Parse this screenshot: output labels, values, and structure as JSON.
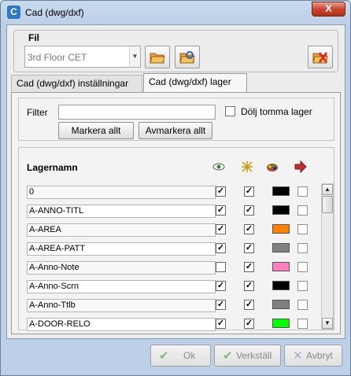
{
  "window": {
    "title": "Cad (dwg/dxf)",
    "close_glyph": "X"
  },
  "fil": {
    "legend": "Fil",
    "selected_file": "3rd Floor CET",
    "buttons": [
      {
        "name": "open-folder-button",
        "icon": "folder-open-icon"
      },
      {
        "name": "reload-file-button",
        "icon": "folder-refresh-icon"
      },
      {
        "name": "remove-file-button",
        "icon": "folder-delete-icon"
      }
    ]
  },
  "tabs": [
    {
      "label": "Cad (dwg/dxf) inställningar",
      "active": false
    },
    {
      "label": "Cad (dwg/dxf) lager",
      "active": true
    }
  ],
  "filter": {
    "label": "Filter",
    "value": "",
    "hide_empty_label": "Dölj tomma lager",
    "hide_empty_checked": false,
    "mark_all": "Markera allt",
    "unmark_all": "Avmarkera allt"
  },
  "grid": {
    "header_name": "Lagernamn",
    "header_icons": [
      "eye-icon",
      "freeze-icon",
      "color-palette-icon",
      "export-arrow-icon"
    ],
    "rows": [
      {
        "name": "0",
        "visible": true,
        "locked": true,
        "color": "#000000",
        "export": false
      },
      {
        "name": "A-ANNO-TITL",
        "visible": true,
        "locked": true,
        "color": "#000000",
        "export": false
      },
      {
        "name": "A-AREA",
        "visible": true,
        "locked": true,
        "color": "#ff7f00",
        "export": false
      },
      {
        "name": "A-AREA-PATT",
        "visible": true,
        "locked": true,
        "color": "#808080",
        "export": false
      },
      {
        "name": "A-Anno-Note",
        "visible": false,
        "locked": true,
        "color": "#ff80c0",
        "export": false
      },
      {
        "name": "A-Anno-Scrn",
        "visible": true,
        "locked": true,
        "color": "#000000",
        "export": false
      },
      {
        "name": "A-Anno-Ttlb",
        "visible": true,
        "locked": true,
        "color": "#808080",
        "export": false
      },
      {
        "name": "A-DOOR-RELO",
        "visible": true,
        "locked": true,
        "color": "#00ff00",
        "export": false
      }
    ]
  },
  "footer": {
    "ok": "Ok",
    "apply": "Verkställ",
    "cancel": "Avbryt"
  }
}
